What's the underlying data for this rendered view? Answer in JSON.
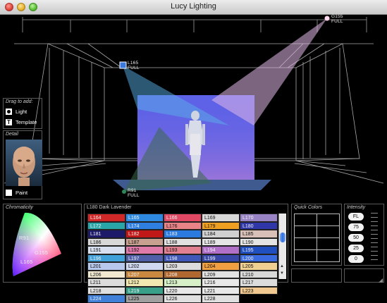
{
  "window": {
    "title": "Lucy Lighting"
  },
  "stage_labels": {
    "g155": {
      "name": "G155",
      "sub": "FULL"
    },
    "l165": {
      "name": "L165",
      "sub": "FULL"
    },
    "r91": {
      "name": "R91",
      "sub": "FULL"
    }
  },
  "drag_panel": {
    "title": "Drag to add:",
    "light_label": "Light",
    "template_label": "Template"
  },
  "detail_panel": {
    "title": "Detail",
    "paint_label": "Paint"
  },
  "chromaticity": {
    "title": "Chromaticity",
    "points": [
      "R91",
      "G155",
      "L165"
    ]
  },
  "gel_panel": {
    "selected": "L180  Dark Lavender",
    "cells": [
      {
        "label": "L164",
        "color": "#d02828"
      },
      {
        "label": "L165",
        "color": "#2e8ae0"
      },
      {
        "label": "L166",
        "color": "#e04864"
      },
      {
        "label": "L169",
        "color": "#d8d8d8"
      },
      {
        "label": "L170",
        "color": "#9884c4"
      },
      {
        "label": "L172",
        "color": "#2aa6a8"
      },
      {
        "label": "L174",
        "color": "#2f7fe0"
      },
      {
        "label": "L176",
        "color": "#e88488"
      },
      {
        "label": "L179",
        "color": "#f0a020"
      },
      {
        "label": "L180",
        "color": "#2e36a8"
      },
      {
        "label": "L181",
        "color": "#1e1a6a"
      },
      {
        "label": "L182",
        "color": "#c01818"
      },
      {
        "label": "L183",
        "color": "#2a7ae0"
      },
      {
        "label": "L184",
        "color": "#d0d0d0"
      },
      {
        "label": "L185",
        "color": "#d8c0b8"
      },
      {
        "label": "L186",
        "color": "#d8d8d8"
      },
      {
        "label": "L187",
        "color": "#c8a090"
      },
      {
        "label": "L188",
        "color": "#e0e0e0"
      },
      {
        "label": "L189",
        "color": "#e4e4e4"
      },
      {
        "label": "L190",
        "color": "#e4e4e4"
      },
      {
        "label": "L191",
        "color": "#d8e0f0"
      },
      {
        "label": "L192",
        "color": "#e07aa8"
      },
      {
        "label": "L193",
        "color": "#e08090"
      },
      {
        "label": "L194",
        "color": "#b070c8"
      },
      {
        "label": "L195",
        "color": "#2050c0"
      },
      {
        "label": "L196",
        "color": "#40a0d8"
      },
      {
        "label": "L197",
        "color": "#5060a8"
      },
      {
        "label": "L198",
        "color": "#4058b8"
      },
      {
        "label": "L199",
        "color": "#3848a8"
      },
      {
        "label": "L200",
        "color": "#3a6ae0"
      },
      {
        "label": "L201",
        "color": "#b8c8ec"
      },
      {
        "label": "L202",
        "color": "#d0d8f0"
      },
      {
        "label": "L203",
        "color": "#dcdcdc"
      },
      {
        "label": "L204",
        "color": "#f0a040"
      },
      {
        "label": "L205",
        "color": "#f0d090"
      },
      {
        "label": "L206",
        "color": "#f0e8d0"
      },
      {
        "label": "L207",
        "color": "#c88840"
      },
      {
        "label": "L208",
        "color": "#b06830"
      },
      {
        "label": "L209",
        "color": "#e0e0e0"
      },
      {
        "label": "L210",
        "color": "#d8d8d8"
      },
      {
        "label": "L211",
        "color": "#dcdcdc"
      },
      {
        "label": "L212",
        "color": "#f0e8b0"
      },
      {
        "label": "L213",
        "color": "#d8f0c8"
      },
      {
        "label": "L216",
        "color": "#e8e8e8"
      },
      {
        "label": "L217",
        "color": "#dcdcdc"
      },
      {
        "label": "L218",
        "color": "#e0e0e0"
      },
      {
        "label": "L219",
        "color": "#38a088"
      },
      {
        "label": "L220",
        "color": "#e8e8e8"
      },
      {
        "label": "L221",
        "color": "#e8e8e8"
      },
      {
        "label": "L223",
        "color": "#f0c890"
      },
      {
        "label": "L224",
        "color": "#4080d8"
      },
      {
        "label": "L225",
        "color": "#a0a0a0"
      },
      {
        "label": "L226",
        "color": "#e0e0e0"
      },
      {
        "label": "L228",
        "color": "#e0e0e0"
      }
    ]
  },
  "quick_colors": {
    "title": "Quick Colors"
  },
  "intensity": {
    "title": "Intensity",
    "buttons": [
      "FL",
      "75",
      "50",
      "25",
      "0"
    ]
  }
}
